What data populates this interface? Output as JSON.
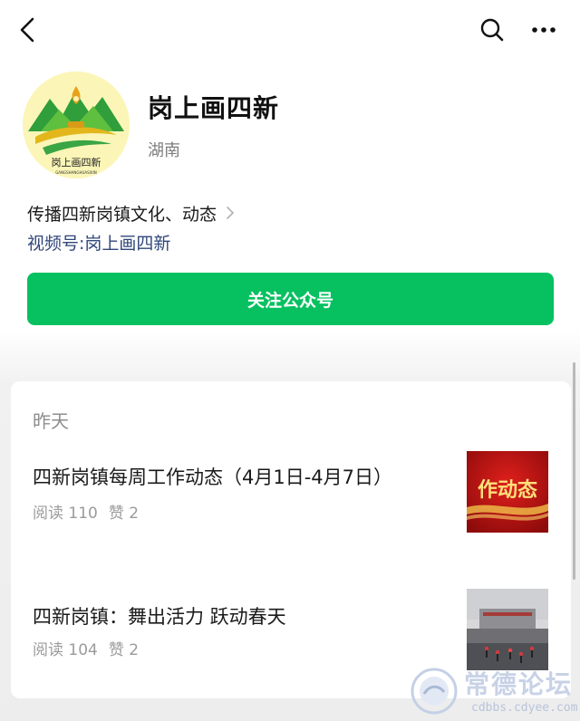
{
  "topbar": {
    "back_icon": "chevron-left-icon",
    "search_icon": "search-icon",
    "more_icon": "more-dots-icon"
  },
  "profile": {
    "name": "岗上画四新",
    "region": "湖南",
    "description": "传播四新岗镇文化、动态",
    "channel_label": "视频号: ",
    "channel_name": "岗上画四新",
    "follow_button": "关注公众号",
    "avatar_caption": "岗上画四新",
    "avatar_pinyin": "GANGSHANGHUASIXIN"
  },
  "feed": {
    "date_label": "昨天",
    "articles": [
      {
        "title": "四新岗镇每周工作动态（4月1日-4月7日）",
        "reads": "阅读 110",
        "likes": "赞 2",
        "thumb_text": "作动态"
      },
      {
        "title": "四新岗镇：舞出活力  跃动春天",
        "reads": "阅读 104",
        "likes": "赞 2"
      }
    ]
  },
  "watermark": {
    "title": "常德论坛",
    "url": "cdbbs.cdyee.com"
  },
  "colors": {
    "accent_green": "#07c160",
    "link_blue": "#30467a",
    "meta_gray": "#9b9b9b"
  }
}
